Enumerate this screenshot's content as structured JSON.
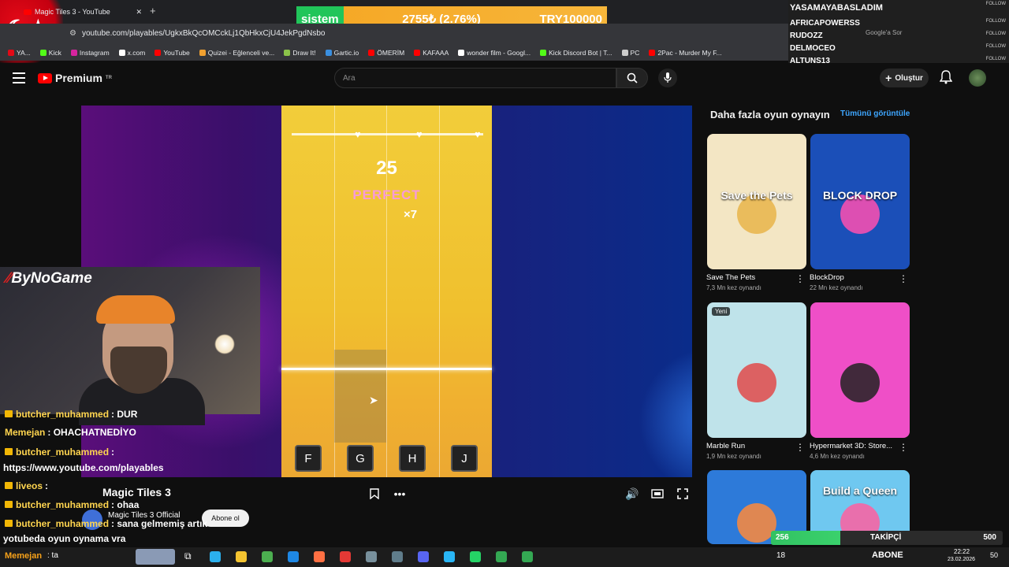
{
  "browser": {
    "tab_title": "Magic Tiles 3 - YouTube",
    "url": "youtube.com/playables/UgkxBkQcOMCckLj1QbHkxCjU4JekPgdNsbo",
    "bookmarks": [
      {
        "label": "YA...",
        "color": "#e30a17"
      },
      {
        "label": "Kick",
        "color": "#53fc18"
      },
      {
        "label": "Instagram",
        "color": "#d6249f"
      },
      {
        "label": "x.com",
        "color": "#ffffff"
      },
      {
        "label": "YouTube",
        "color": "#ff0000"
      },
      {
        "label": "Quizei - Eğlenceli ve...",
        "color": "#f0a030"
      },
      {
        "label": "Draw It!",
        "color": "#8bc34a"
      },
      {
        "label": "Gartic.io",
        "color": "#3a8fe0"
      },
      {
        "label": "ÖMERİM",
        "color": "#ff0000"
      },
      {
        "label": "KAFAAA",
        "color": "#ff0000"
      },
      {
        "label": "wonder film - Googl...",
        "color": "#ffffff"
      },
      {
        "label": "Kick Discord Bot | T...",
        "color": "#53fc18"
      },
      {
        "label": "PC",
        "color": "#cccccc"
      },
      {
        "label": "2Pac - Murder My F...",
        "color": "#ff0000"
      }
    ],
    "google_search": "Google'a Sor"
  },
  "stream_overlay": {
    "ticker_label": "sistem",
    "ticker_value": "2755₺ (2.76%)",
    "ticker_goal": "TRY100000",
    "followers": [
      "YASAMAYABASLADIM",
      "AFRICAPOWERSS",
      "RUDOZZ",
      "DELMOCEO",
      "ALTUNS13"
    ],
    "follow_tag": "FOLLOW",
    "cam_name": "ByNoGame",
    "follow_bar": {
      "current": "256",
      "label": "TAKİPÇİ",
      "goal": "500"
    },
    "subs_label": "ABONE",
    "subs_count": "18",
    "taskbar_time": "22:22",
    "taskbar_date": "23.02.2026",
    "taskbar_badge": "50"
  },
  "youtube": {
    "brand": "Premium",
    "brand_sup": "TR",
    "search_placeholder": "Ara",
    "create_label": "Oluştur",
    "game": {
      "score": "25",
      "rating": "PERFECT",
      "combo": "×7",
      "keys": [
        "F",
        "G",
        "H",
        "J"
      ],
      "title": "Magic Tiles 3",
      "channel": "Magic Tiles 3 Official",
      "subscribe": "Abone ol"
    },
    "more_games": {
      "title": "Daha fazla oyun oynayın",
      "see_all": "Tümünü görüntüle",
      "cards": [
        {
          "name": "Save The Pets",
          "plays": "7,3 Mn kez oynandı",
          "bg": "#f3e6c4",
          "accent": "#e8b44a",
          "label": "Save the Pets"
        },
        {
          "name": "BlockDrop",
          "plays": "22 Mn kez oynandı",
          "bg": "#1b4fb8",
          "accent": "#ff4fb0",
          "label": "BLOCK DROP"
        },
        {
          "name": "Marble Run",
          "plays": "1,9 Mn kez oynandı",
          "bg": "#bfe3ea",
          "accent": "#e04a4a",
          "label": "",
          "badge": "Yeni"
        },
        {
          "name": "Hypermarket 3D: Store...",
          "plays": "4,6 Mn kez oynandı",
          "bg": "#ef4fc7",
          "accent": "#222222",
          "label": ""
        },
        {
          "name": "",
          "plays": "",
          "bg": "#2d7ad9",
          "accent": "#ff8a3a",
          "label": ""
        },
        {
          "name": "",
          "plays": "",
          "bg": "#6fc8f0",
          "accent": "#ff5fa0",
          "label": "Build a Queen"
        }
      ]
    }
  },
  "chat": [
    {
      "user": "butcher_muhammed",
      "msg": ": DUR",
      "badge": true
    },
    {
      "user": "Memejan",
      "msg": ": OHACHATNEDİYO",
      "badge": false
    },
    {
      "user": "butcher_muhammed",
      "msg": ":",
      "badge": true
    },
    {
      "user": "",
      "msg": "https://www.youtube.com/playables",
      "badge": false
    },
    {
      "user": "liveos",
      "msg": ":",
      "badge": true
    },
    {
      "user": "butcher_muhammed",
      "msg": ": ohaa",
      "badge": true
    },
    {
      "user": "butcher_muhammed",
      "msg": ": sana gelmemiş artık",
      "badge": true
    },
    {
      "user": "",
      "msg": "yotubeda oyun oynama vra",
      "badge": false
    },
    {
      "user": "Memejan",
      "msg": ": ta",
      "badge": false
    }
  ]
}
